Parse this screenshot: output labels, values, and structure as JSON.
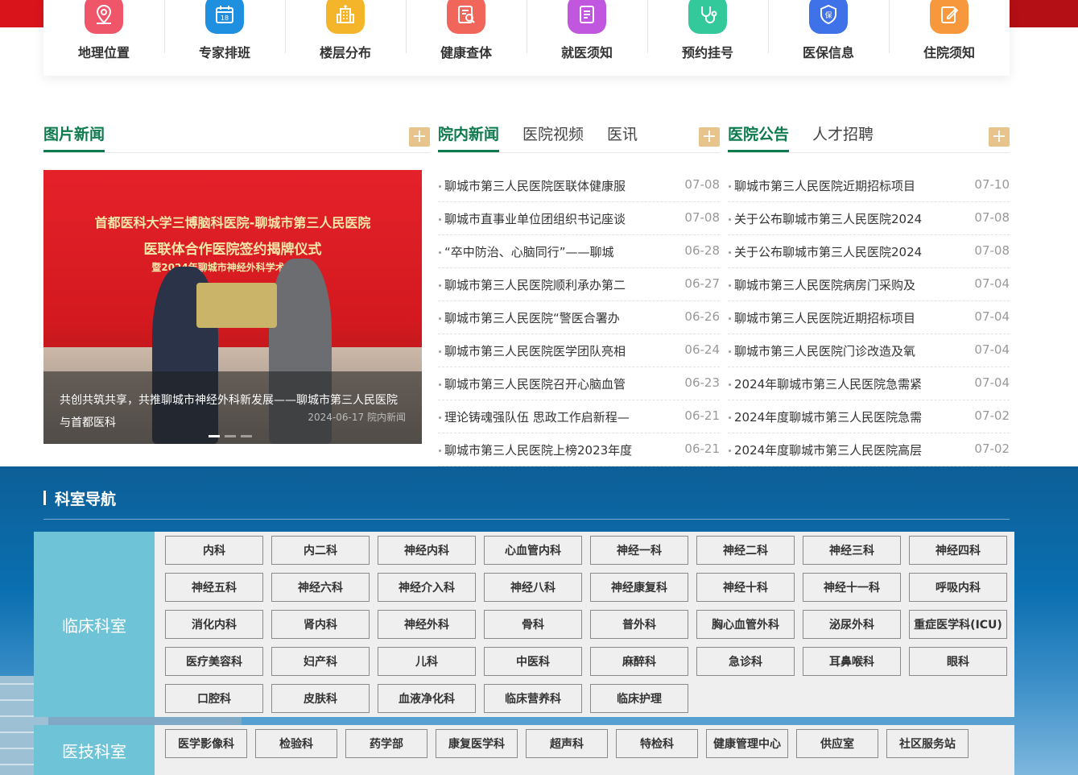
{
  "colors": {
    "brand_green": "#0d7a4d",
    "top_red": "#d9141b",
    "plus_tan": "#e7c48b",
    "dept_blue": "#0a6fb0",
    "dept_teal": "#6fc3d7"
  },
  "quick_nav": [
    {
      "label": "地理位置",
      "icon": "location-pin-icon",
      "color": "#f0566a"
    },
    {
      "label": "专家排班",
      "icon": "calendar-icon",
      "color": "#1f8fe0"
    },
    {
      "label": "楼层分布",
      "icon": "building-icon",
      "color": "#f5b52a"
    },
    {
      "label": "健康查体",
      "icon": "report-search-icon",
      "color": "#f0665a"
    },
    {
      "label": "就医须知",
      "icon": "document-icon",
      "color": "#c057de"
    },
    {
      "label": "预约挂号",
      "icon": "stethoscope-icon",
      "color": "#33c99b"
    },
    {
      "label": "医保信息",
      "icon": "shield-icon",
      "color": "#3f71e8"
    },
    {
      "label": "住院须知",
      "icon": "edit-icon",
      "color": "#f7983d"
    }
  ],
  "photo_news": {
    "heading": "图片新闻",
    "more": "+",
    "banner_line1": "首都医科大学三博脑科医院-聊城市第三人民医院",
    "banner_line2": "医联体合作医院签约揭牌仪式",
    "banner_line3": "暨2024年聊城市神经外科学术会年会",
    "caption_title": "共创共筑共享，共推聊城市神经外科新发展——聊城市第三人民医院与首都医科",
    "caption_date": "2024-06-17",
    "caption_category": "院内新闻"
  },
  "hospital_news": {
    "tabs": [
      "院内新闻",
      "医院视频",
      "医讯"
    ],
    "more": "+",
    "items": [
      {
        "title": "聊城市第三人民医院医联体健康服",
        "date": "07-08"
      },
      {
        "title": "聊城市直事业单位团组织书记座谈",
        "date": "07-08"
      },
      {
        "title": "“卒中防治、心脑同行”——聊城",
        "date": "06-28"
      },
      {
        "title": "聊城市第三人民医院顺利承办第二",
        "date": "06-27"
      },
      {
        "title": "聊城市第三人民医院“警医合署办",
        "date": "06-26"
      },
      {
        "title": "聊城市第三人民医院医学团队亮相",
        "date": "06-24"
      },
      {
        "title": "聊城市第三人民医院召开心脑血管",
        "date": "06-23"
      },
      {
        "title": "理论铸魂强队伍 思政工作启新程—",
        "date": "06-21"
      },
      {
        "title": "聊城市第三人民医院上榜2023年度",
        "date": "06-21"
      }
    ]
  },
  "announcements": {
    "tabs": [
      "医院公告",
      "人才招聘"
    ],
    "more": "+",
    "items": [
      {
        "title": "聊城市第三人民医院近期招标项目",
        "date": "07-10"
      },
      {
        "title": "关于公布聊城市第三人民医院2024",
        "date": "07-08"
      },
      {
        "title": "关于公布聊城市第三人民医院2024",
        "date": "07-08"
      },
      {
        "title": "聊城市第三人民医院病房门采购及",
        "date": "07-04"
      },
      {
        "title": "聊城市第三人民医院近期招标项目",
        "date": "07-04"
      },
      {
        "title": "聊城市第三人民医院门诊改造及氧",
        "date": "07-04"
      },
      {
        "title": "2024年聊城市第三人民医院急需紧",
        "date": "07-04"
      },
      {
        "title": "2024年度聊城市第三人民医院急需",
        "date": "07-02"
      },
      {
        "title": "2024年度聊城市第三人民医院高层",
        "date": "07-02"
      }
    ]
  },
  "departments": {
    "heading": "科室导航",
    "clinical": {
      "label": "临床科室",
      "items": [
        "内科",
        "内二科",
        "神经内科",
        "心血管内科",
        "神经一科",
        "神经二科",
        "神经三科",
        "神经四科",
        "神经五科",
        "神经六科",
        "神经介入科",
        "神经八科",
        "神经康复科",
        "神经十科",
        "神经十一科",
        "呼吸内科",
        "消化内科",
        "肾内科",
        "神经外科",
        "骨科",
        "普外科",
        "胸心血管外科",
        "泌尿外科",
        "重症医学科(ICU)",
        "医疗美容科",
        "妇产科",
        "儿科",
        "中医科",
        "麻醉科",
        "急诊科",
        "耳鼻喉科",
        "眼科",
        "口腔科",
        "皮肤科",
        "血液净化科",
        "临床营养科",
        "临床护理"
      ]
    },
    "medtech": {
      "label": "医技科室",
      "items": [
        "医学影像科",
        "检验科",
        "药学部",
        "康复医学科",
        "超声科",
        "特检科",
        "健康管理中心",
        "供应室",
        "社区服务站"
      ]
    }
  }
}
